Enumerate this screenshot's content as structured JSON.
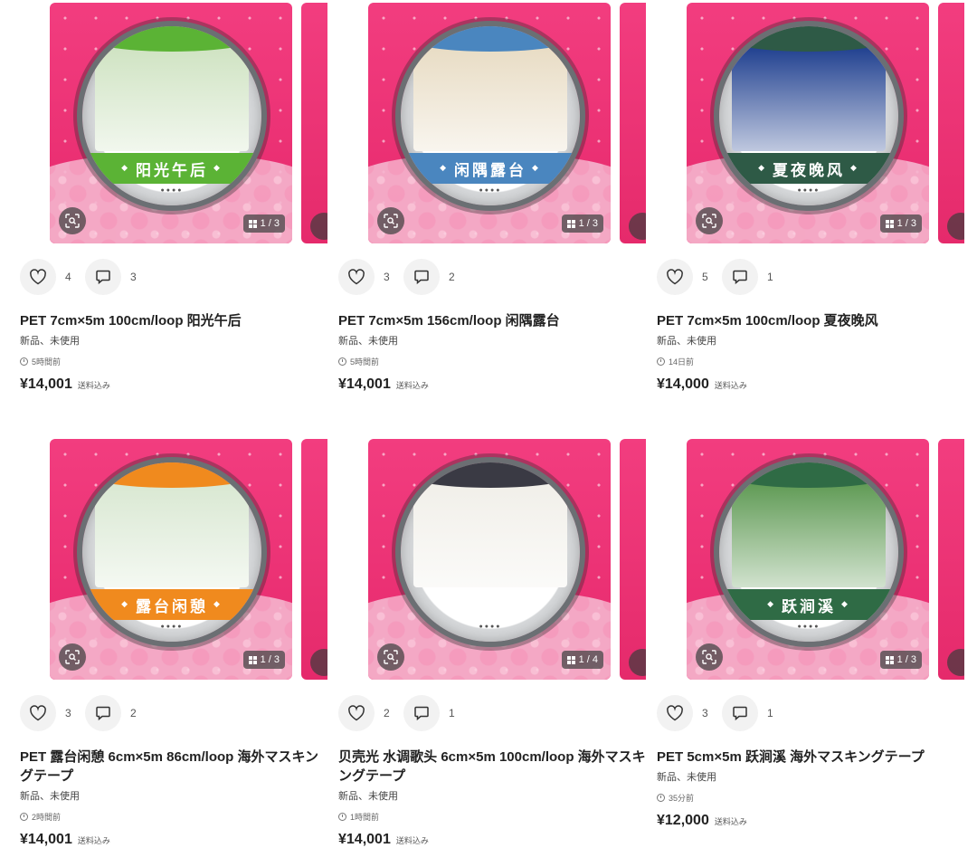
{
  "items": [
    {
      "title": "PET 7cm×5m 100cm/loop 阳光午后",
      "condition": "新品、未使用",
      "time": "5時間前",
      "price": "¥14,001",
      "shipping": "送料込み",
      "likes": "4",
      "comments": "3",
      "image_counter": "1 / 3",
      "tape_label": "阳光午后",
      "tape_color": "#5bb335",
      "scene_color": "#cfe3c2"
    },
    {
      "title": "PET 7cm×5m 156cm/loop 闲隅露台",
      "condition": "新品、未使用",
      "time": "5時間前",
      "price": "¥14,001",
      "shipping": "送料込み",
      "likes": "3",
      "comments": "2",
      "image_counter": "1 / 3",
      "tape_label": "闲隅露台",
      "tape_color": "#4a86bf",
      "scene_color": "#e8dcc4"
    },
    {
      "title": "PET 7cm×5m 100cm/loop 夏夜晚风",
      "condition": "新品、未使用",
      "time": "14日前",
      "price": "¥14,000",
      "shipping": "送料込み",
      "likes": "5",
      "comments": "1",
      "image_counter": "1 / 3",
      "tape_label": "夏夜晚风",
      "tape_color": "#2e5a46",
      "scene_color": "#1f3f8f"
    },
    {
      "title": "PET 露台闲憩 6cm×5m 86cm/loop 海外マスキングテープ",
      "condition": "新品、未使用",
      "time": "2時間前",
      "price": "¥14,001",
      "shipping": "送料込み",
      "likes": "3",
      "comments": "2",
      "image_counter": "1 / 3",
      "tape_label": "露台闲憩",
      "tape_color": "#f08a1e",
      "scene_color": "#d9e8d2"
    },
    {
      "title": "贝壳光 水调歌头 6cm×5m 100cm/loop 海外マスキングテープ",
      "condition": "新品、未使用",
      "time": "1時間前",
      "price": "¥14,001",
      "shipping": "送料込み",
      "likes": "2",
      "comments": "1",
      "image_counter": "1 / 4",
      "tape_label": "",
      "tape_color": "#3a3a44",
      "scene_color": "#f1efe9"
    },
    {
      "title": "PET 5cm×5m 跃涧溪 海外マスキングテープ",
      "condition": "新品、未使用",
      "time": "35分前",
      "price": "¥12,000",
      "shipping": "送料込み",
      "likes": "3",
      "comments": "1",
      "image_counter": "1 / 3",
      "tape_label": "跃涧溪",
      "tape_color": "#2f6b45",
      "scene_color": "#5f9a54"
    }
  ],
  "colors": {
    "backdrop_pink": "#ea2f72",
    "lace_pink": "#f6b6cf"
  }
}
